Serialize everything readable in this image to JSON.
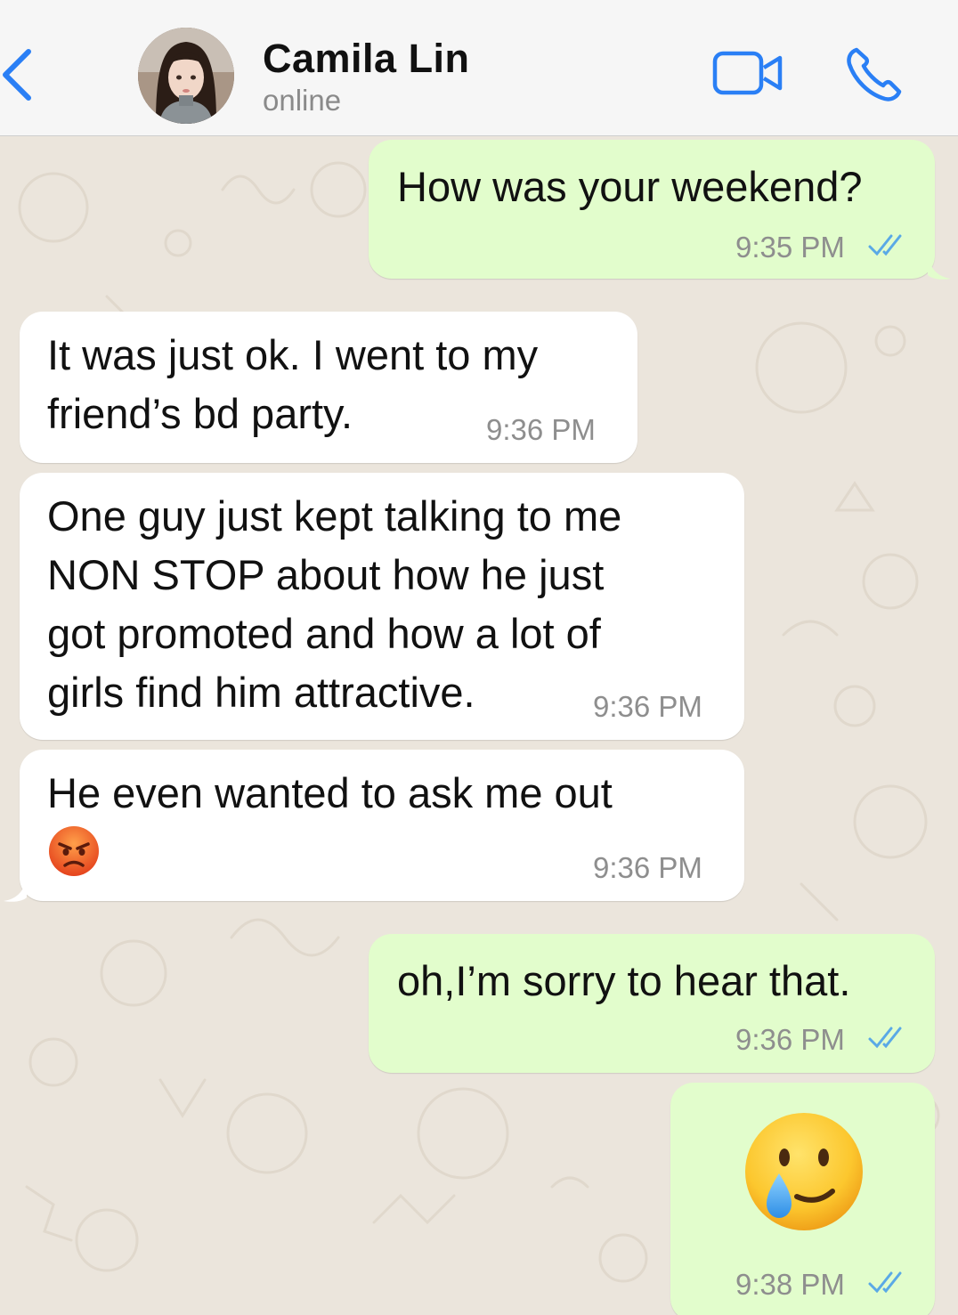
{
  "header": {
    "contact_name": "Camila Lin",
    "contact_status": "online",
    "back_icon": "chevron-left-icon",
    "video_icon": "video-camera-icon",
    "call_icon": "phone-icon",
    "accent_color": "#2a7ff5"
  },
  "messages": [
    {
      "direction": "outgoing",
      "text": "How was your weekend?",
      "time": "9:35 PM",
      "status": "read"
    },
    {
      "direction": "incoming",
      "text": "It was just ok. I went to my\nfriend’s bd party.",
      "time": "9:36 PM"
    },
    {
      "direction": "incoming",
      "text": "One guy just kept talking to me\nNON STOP about how he just\ngot promoted and how a lot of\ngirls find him attractive.",
      "time": "9:36 PM"
    },
    {
      "direction": "incoming",
      "text": "He even wanted to ask me out",
      "emoji": "angry-face-emoji",
      "time": "9:36 PM"
    },
    {
      "direction": "outgoing",
      "text": "oh,I’m sorry to hear that.",
      "time": "9:36 PM",
      "status": "read"
    },
    {
      "direction": "outgoing",
      "emoji": "face-holding-back-tears-emoji",
      "time": "9:38 PM",
      "status": "read"
    }
  ],
  "colors": {
    "outgoing_bubble": "#e2fdcc",
    "incoming_bubble": "#ffffff",
    "read_ticks": "#5aa9e6",
    "chat_background": "#ebe5dc"
  }
}
